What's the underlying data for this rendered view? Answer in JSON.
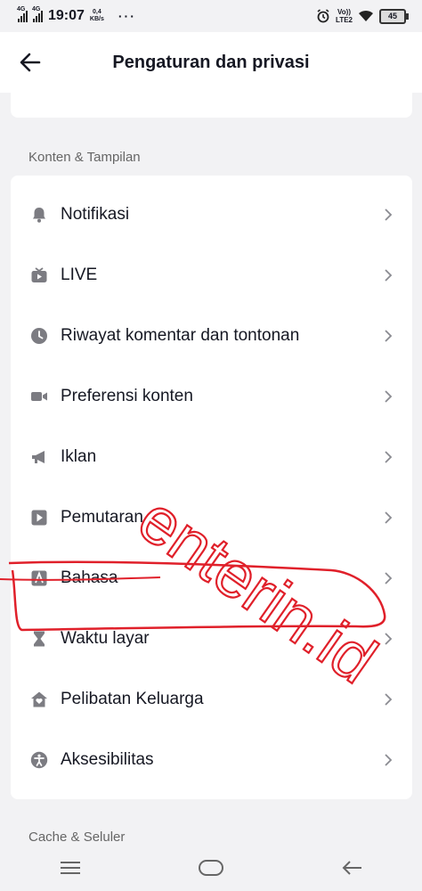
{
  "status_bar": {
    "network_1": "4G",
    "network_2": "4G",
    "time": "19:07",
    "speed_value": "0,4",
    "speed_unit": "KB/s",
    "more": "···",
    "volte_top": "Vo))",
    "volte_bottom": "LTE2",
    "battery": "45"
  },
  "header": {
    "title": "Pengaturan dan privasi"
  },
  "section_content": {
    "label": "Konten & Tampilan",
    "items": [
      {
        "label": "Notifikasi",
        "icon": "bell-icon"
      },
      {
        "label": "LIVE",
        "icon": "live-tv-icon"
      },
      {
        "label": "Riwayat komentar dan tontonan",
        "icon": "clock-icon"
      },
      {
        "label": "Preferensi konten",
        "icon": "video-camera-icon"
      },
      {
        "label": "Iklan",
        "icon": "megaphone-icon"
      },
      {
        "label": "Pemutaran",
        "icon": "play-icon"
      },
      {
        "label": "Bahasa",
        "icon": "language-icon"
      },
      {
        "label": "Waktu layar",
        "icon": "hourglass-icon"
      },
      {
        "label": "Pelibatan Keluarga",
        "icon": "family-home-icon"
      },
      {
        "label": "Aksesibilitas",
        "icon": "accessibility-icon"
      }
    ]
  },
  "section_cache": {
    "label": "Cache & Seluler"
  },
  "watermark": {
    "text": "enterin.id",
    "color": "#e0202a"
  },
  "colors": {
    "background": "#f2f2f4",
    "card": "#ffffff",
    "text": "#161823",
    "icon": "#7c7c82",
    "section_text": "#666666"
  }
}
